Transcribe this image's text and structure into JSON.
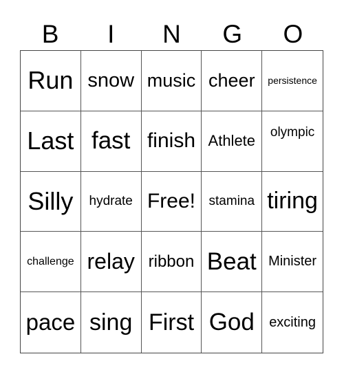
{
  "header": {
    "letters": [
      "B",
      "I",
      "N",
      "G",
      "O"
    ]
  },
  "board": {
    "rows": [
      [
        "Run",
        "snow",
        "music",
        "cheer",
        "persistence"
      ],
      [
        "Last",
        "fast",
        "finish",
        "Athlete",
        "olympic"
      ],
      [
        "Silly",
        "hydrate",
        "Free!",
        "stamina",
        "tiring"
      ],
      [
        "challenge",
        "relay",
        "ribbon",
        "Beat",
        "Minister"
      ],
      [
        "pace",
        "sing",
        "First",
        "God",
        "exciting"
      ]
    ]
  }
}
